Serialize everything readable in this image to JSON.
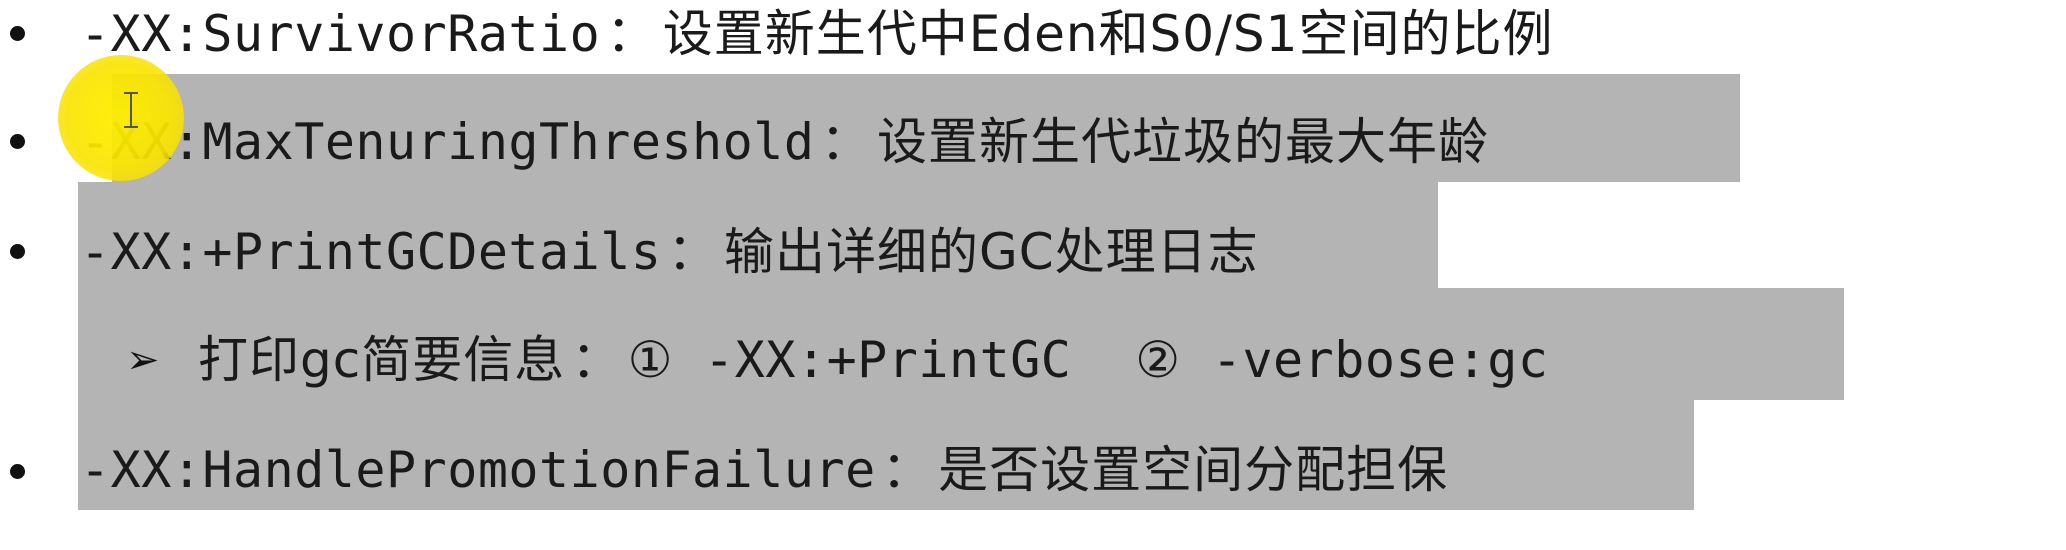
{
  "items": [
    {
      "option": "-XX:SurvivorRatio",
      "separator": "：",
      "description": "设置新生代中Eden和S0/S1空间的比例"
    },
    {
      "option": "-XX:MaxTenuringThreshold",
      "separator": "：",
      "description": "设置新生代垃圾的最大年龄"
    },
    {
      "option": "-XX:+PrintGCDetails",
      "separator": "：",
      "description": "输出详细的GC处理日志"
    },
    {
      "option": "-XX:HandlePromotionFailure",
      "separator": "：",
      "description": "是否设置空间分配担保"
    }
  ],
  "sub_item": {
    "arrow": "➢",
    "label": "打印gc简要信息",
    "separator": "：",
    "opt1_marker": "①",
    "opt1": "-XX:+PrintGC",
    "opt2_marker": "②",
    "opt2": "-verbose:gc"
  },
  "highlight_color": "#b4b4b4",
  "cursor_highlight_color": "#ffee00"
}
